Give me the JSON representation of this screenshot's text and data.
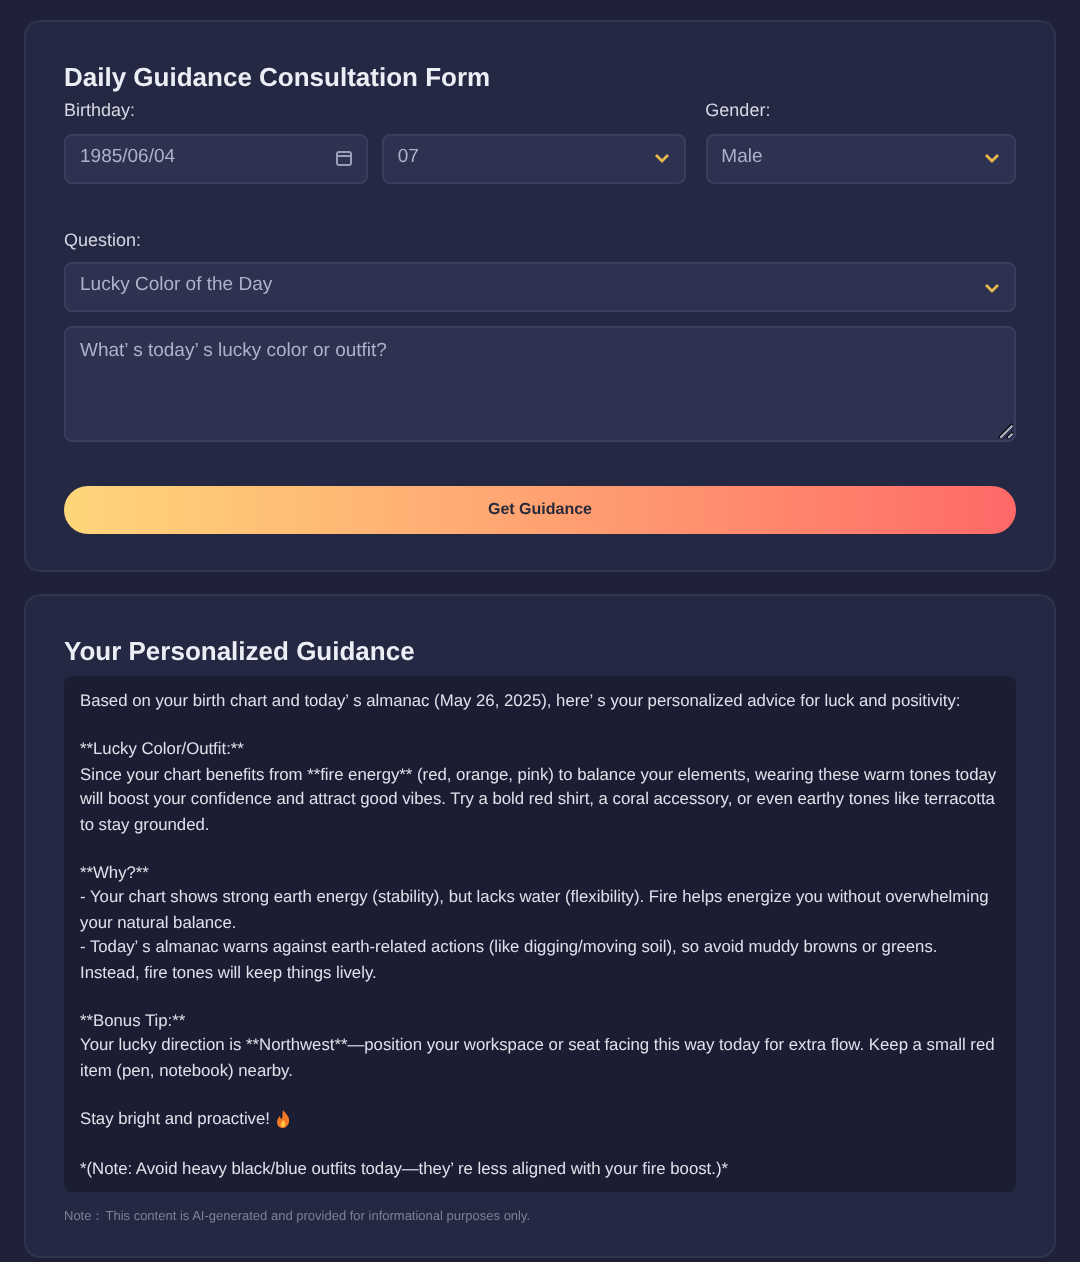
{
  "form": {
    "title": "Daily Guidance Consultation Form",
    "birthday": {
      "label": "Birthday:",
      "date": "1985/06/04",
      "hour": "07"
    },
    "gender": {
      "label": "Gender:",
      "value": "Male"
    },
    "question": {
      "label": "Question:",
      "value": "Lucky Color of the Day",
      "placeholder": "What’ s today’ s lucky color or outfit?"
    },
    "button": "Get Guidance"
  },
  "result": {
    "title": "Your Personalized Guidance",
    "paragraphs": [
      {
        "kind": "text",
        "lines": [
          "Based on your birth chart and today’ s almanac (May 26, 2025), here’ s your personalized advice for luck and positivity:"
        ]
      },
      {
        "kind": "text",
        "lines": [
          "**Lucky Color/Outfit:**",
          "Since your chart benefits from **fire energy** (red, orange, pink) to balance your elements, wearing these warm tones today will boost your confidence and attract good vibes. Try a bold red shirt, a coral accessory, or even earthy tones like terracotta to stay grounded."
        ]
      },
      {
        "kind": "text",
        "lines": [
          "**Why?**",
          "- Your chart shows strong earth energy (stability), but lacks water (flexibility). Fire helps energize you without overwhelming your natural balance.",
          "- Today’ s almanac warns against earth-related actions (like digging/moving soil), so avoid muddy browns or greens. Instead, fire tones will keep things lively."
        ]
      },
      {
        "kind": "text",
        "lines": [
          "**Bonus Tip:**",
          "Your lucky direction is **Northwest**—position your workspace or seat facing this way today for extra flow. Keep a small red item (pen, notebook) nearby."
        ]
      },
      {
        "kind": "flame",
        "lines": [
          "Stay bright and proactive!"
        ]
      },
      {
        "kind": "text",
        "lines": [
          "*(Note: Avoid heavy black/blue outfits today—they’ re less aligned with your fire boost.)*"
        ]
      }
    ],
    "note": "Note：This content is AI-generated and provided for informational purposes only."
  }
}
